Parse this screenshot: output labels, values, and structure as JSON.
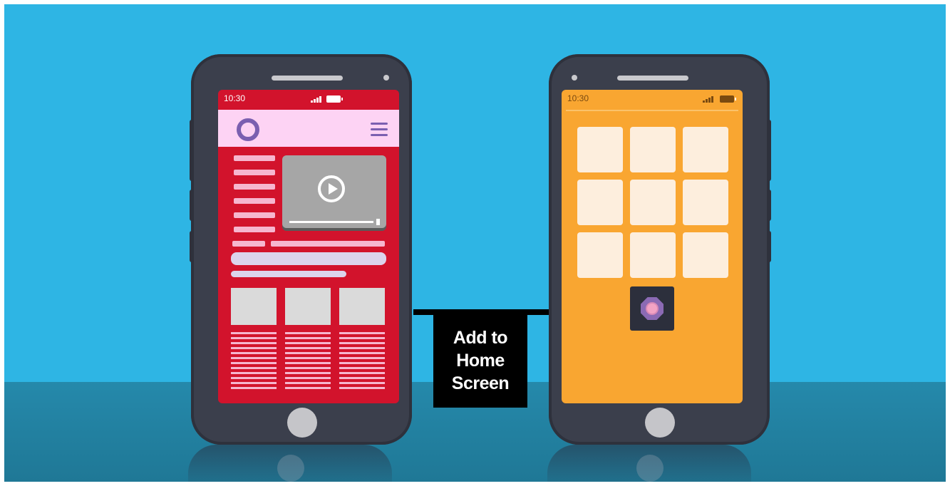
{
  "left_phone": {
    "status_time": "10:30",
    "screen_color": "#d2132c",
    "appbar_color": "#fdd3f4",
    "logo_icon": "hexagon-ring-logo",
    "menu_icon": "hamburger-menu",
    "media_icon": "play-button"
  },
  "right_phone": {
    "status_time": "10:30",
    "screen_color": "#f9a631",
    "tile_count": 9,
    "new_app_icon": "octagon-app-icon"
  },
  "arrow": {
    "label": "Add to Home Screen"
  },
  "colors": {
    "background": "#2eb5e4",
    "floor": "#1f7896",
    "phone_body": "#3b3f4c",
    "accent_purple": "#7b5fb0"
  }
}
